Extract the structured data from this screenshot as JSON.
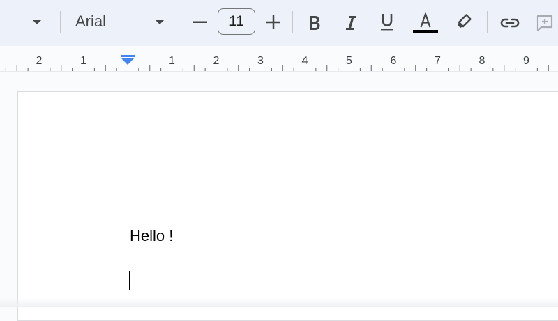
{
  "toolbar": {
    "font_family": "Arial",
    "font_size": "11",
    "text_color_accent": "#000000",
    "icons": {
      "style_dropdown": "chevron-down-icon",
      "font_dropdown": "chevron-down-icon",
      "decrease": "minus-icon",
      "increase": "plus-icon",
      "bold": "bold-icon",
      "italic": "italic-icon",
      "underline": "underline-icon",
      "text_color": "text-color-icon",
      "highlight": "highlighter-icon",
      "link": "link-icon",
      "comment": "add-comment-icon"
    }
  },
  "ruler": {
    "left_labels": [
      "2",
      "1"
    ],
    "right_labels": [
      "1",
      "2",
      "3",
      "4",
      "5",
      "6",
      "7",
      "8",
      "9"
    ],
    "indent_marker_color": "#4285f4"
  },
  "document": {
    "lines": [
      "Hello !"
    ]
  }
}
